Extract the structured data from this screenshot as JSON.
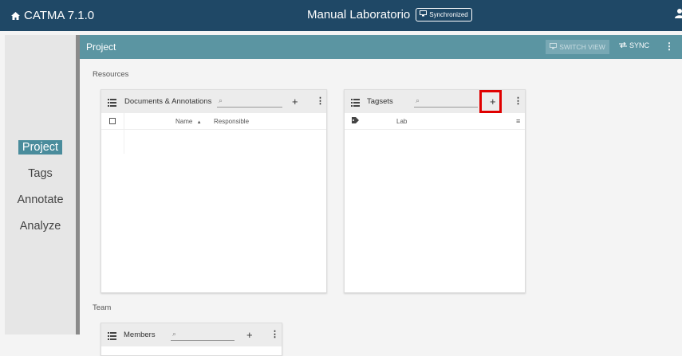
{
  "app": {
    "name": "CATMA 7.1.0",
    "doc_title": "Manual Laboratorio",
    "sync_status": "Synchronized"
  },
  "nav": {
    "items": [
      {
        "label": "Project",
        "active": true
      },
      {
        "label": "Tags",
        "active": false
      },
      {
        "label": "Annotate",
        "active": false
      },
      {
        "label": "Analyze",
        "active": false
      }
    ]
  },
  "project_bar": {
    "title": "Project",
    "switch_view": "SWITCH VIEW",
    "sync": "SYNC",
    "menu": "⋮"
  },
  "sections": {
    "resources": "Resources",
    "team": "Team"
  },
  "documents_card": {
    "title": "Documents & Annotations",
    "search_placeholder": "",
    "add": "+",
    "menu": "⋮",
    "columns": {
      "name": "Name",
      "sort": "▲",
      "responsible": "Responsible"
    }
  },
  "tagsets_card": {
    "title": "Tagsets",
    "search_placeholder": "",
    "add": "+",
    "menu": "⋮",
    "rows": [
      {
        "name": "Lab",
        "menu": "≡"
      }
    ]
  },
  "members_card": {
    "title": "Members",
    "add": "+",
    "menu": "⋮"
  },
  "colors": {
    "topbar": "#1f4866",
    "accent": "#5b95a2",
    "highlight": "#e00000"
  }
}
